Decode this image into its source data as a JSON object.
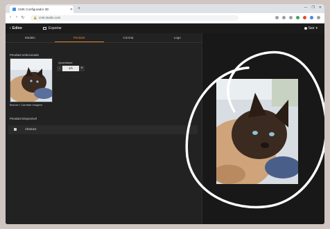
{
  "browser": {
    "tab_title": "CMK Configurador 3D",
    "new_tab": "+",
    "url": "cmk.studio.com",
    "window_controls": [
      "—",
      "❐",
      "✕"
    ],
    "toolbar_icon_colors": [
      "#9aa0a6",
      "#9aa0a6",
      "#9aa0a6",
      "#34a853",
      "#ea4335",
      "#4285f4",
      "#9aa0a6"
    ]
  },
  "appbar": {
    "back_label": "Editor",
    "export_label": "Exportar",
    "user_label": "Sair"
  },
  "tabs": [
    "Modelo",
    "Pendant",
    "Correia",
    "Logo"
  ],
  "active_tab_index": 1,
  "panel": {
    "selected_pendant_label": "Pendant selecionado",
    "caption": "Bronze • Cambiar Imagem",
    "quantity_label": "Quantidade",
    "quantity_value": "1/1",
    "minus": "-",
    "plus": "+",
    "filters_label": "Pendant Disponível",
    "filter_row_label": "Abstract"
  },
  "colors": {
    "accent": "#e0832e",
    "background": "#1f1f1f",
    "scribble": "#ffffff"
  }
}
